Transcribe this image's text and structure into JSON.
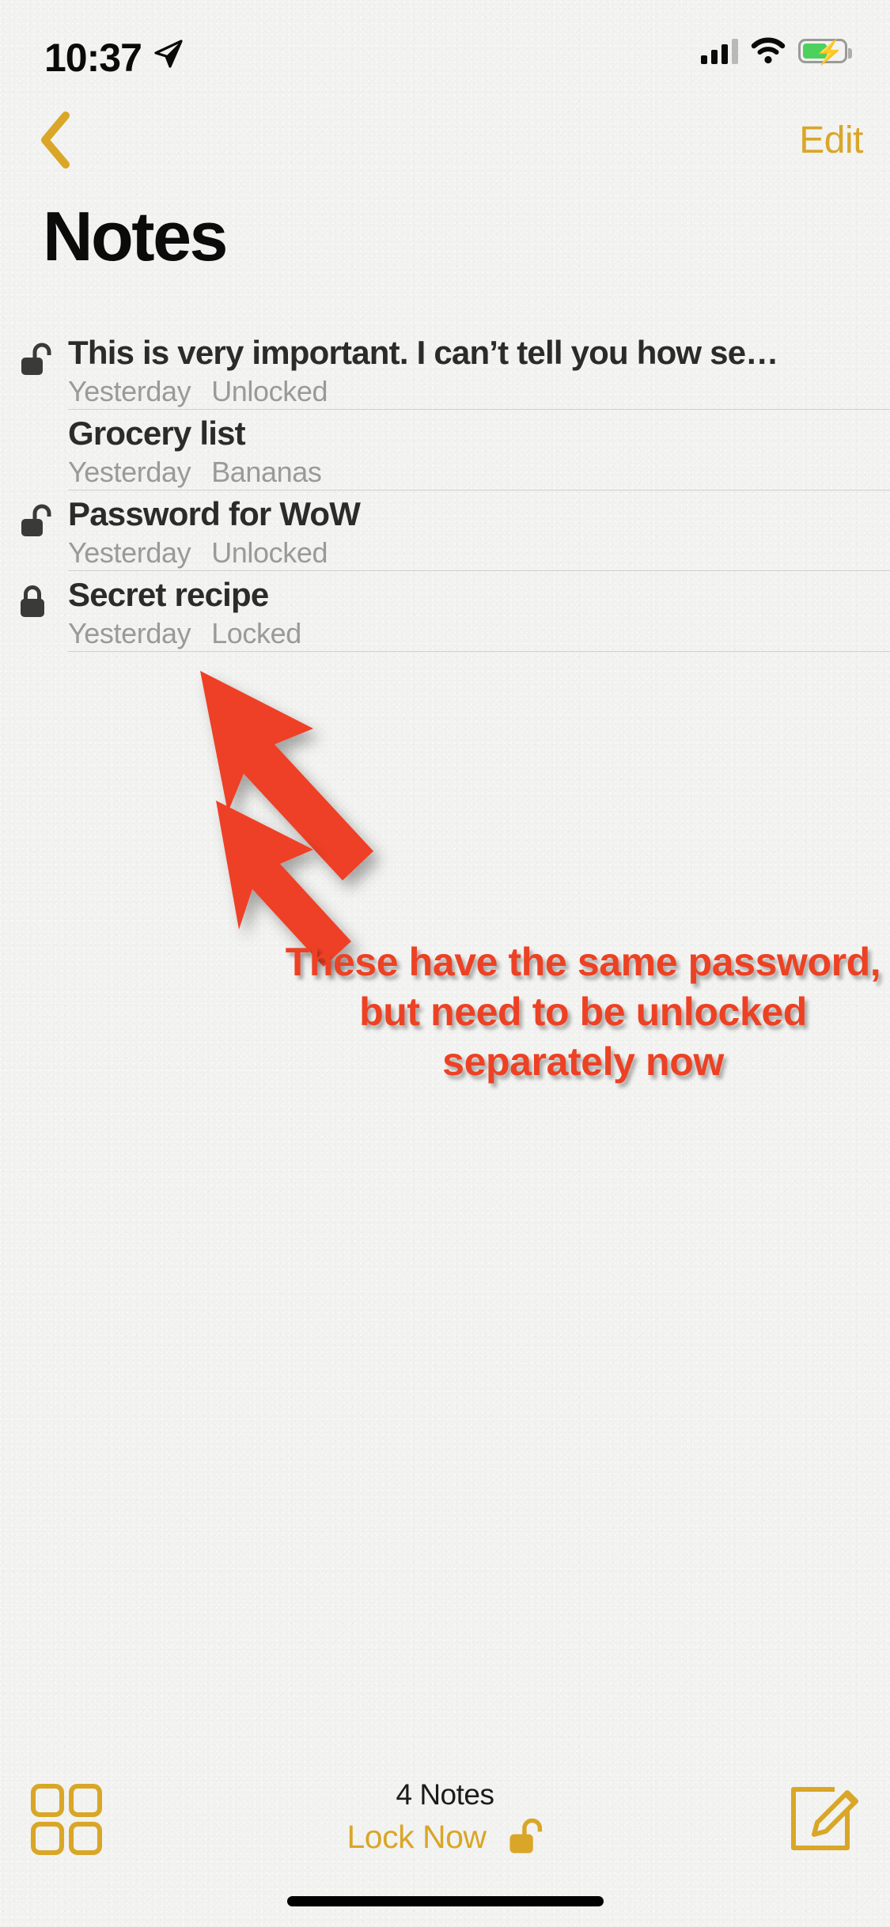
{
  "status_bar": {
    "time": "10:37",
    "location_icon": "location-arrow-icon",
    "signal_icon": "cellular-signal-icon",
    "wifi_icon": "wifi-icon",
    "battery_icon": "battery-charging-icon",
    "battery_color": "#4cd05e"
  },
  "nav": {
    "back_icon": "chevron-left-icon",
    "edit_label": "Edit",
    "accent_color": "#d9a627"
  },
  "header": {
    "title": "Notes"
  },
  "notes": [
    {
      "lock_icon": "unlocked-padlock-icon",
      "locked": false,
      "title": "This is very important. I can’t tell you how se…",
      "date": "Yesterday",
      "snippet": "Unlocked"
    },
    {
      "lock_icon": "",
      "locked": null,
      "title": "Grocery list",
      "date": "Yesterday",
      "snippet": "Bananas"
    },
    {
      "lock_icon": "unlocked-padlock-icon",
      "locked": false,
      "title": "Password for WoW",
      "date": "Yesterday",
      "snippet": "Unlocked"
    },
    {
      "lock_icon": "locked-padlock-icon",
      "locked": true,
      "title": "Secret recipe",
      "date": "Yesterday",
      "snippet": "Locked"
    }
  ],
  "annotation": {
    "text": "These have the same password, but need to be unlocked separately now",
    "color": "#ed4124",
    "arrows": 2
  },
  "toolbar": {
    "grid_icon": "grid-folders-icon",
    "count_label": "4 Notes",
    "lock_now_label": "Lock Now",
    "lock_now_icon": "unlocked-padlock-icon",
    "compose_icon": "compose-note-icon",
    "accent_color": "#d9a627"
  },
  "home_indicator": "home-indicator-bar"
}
